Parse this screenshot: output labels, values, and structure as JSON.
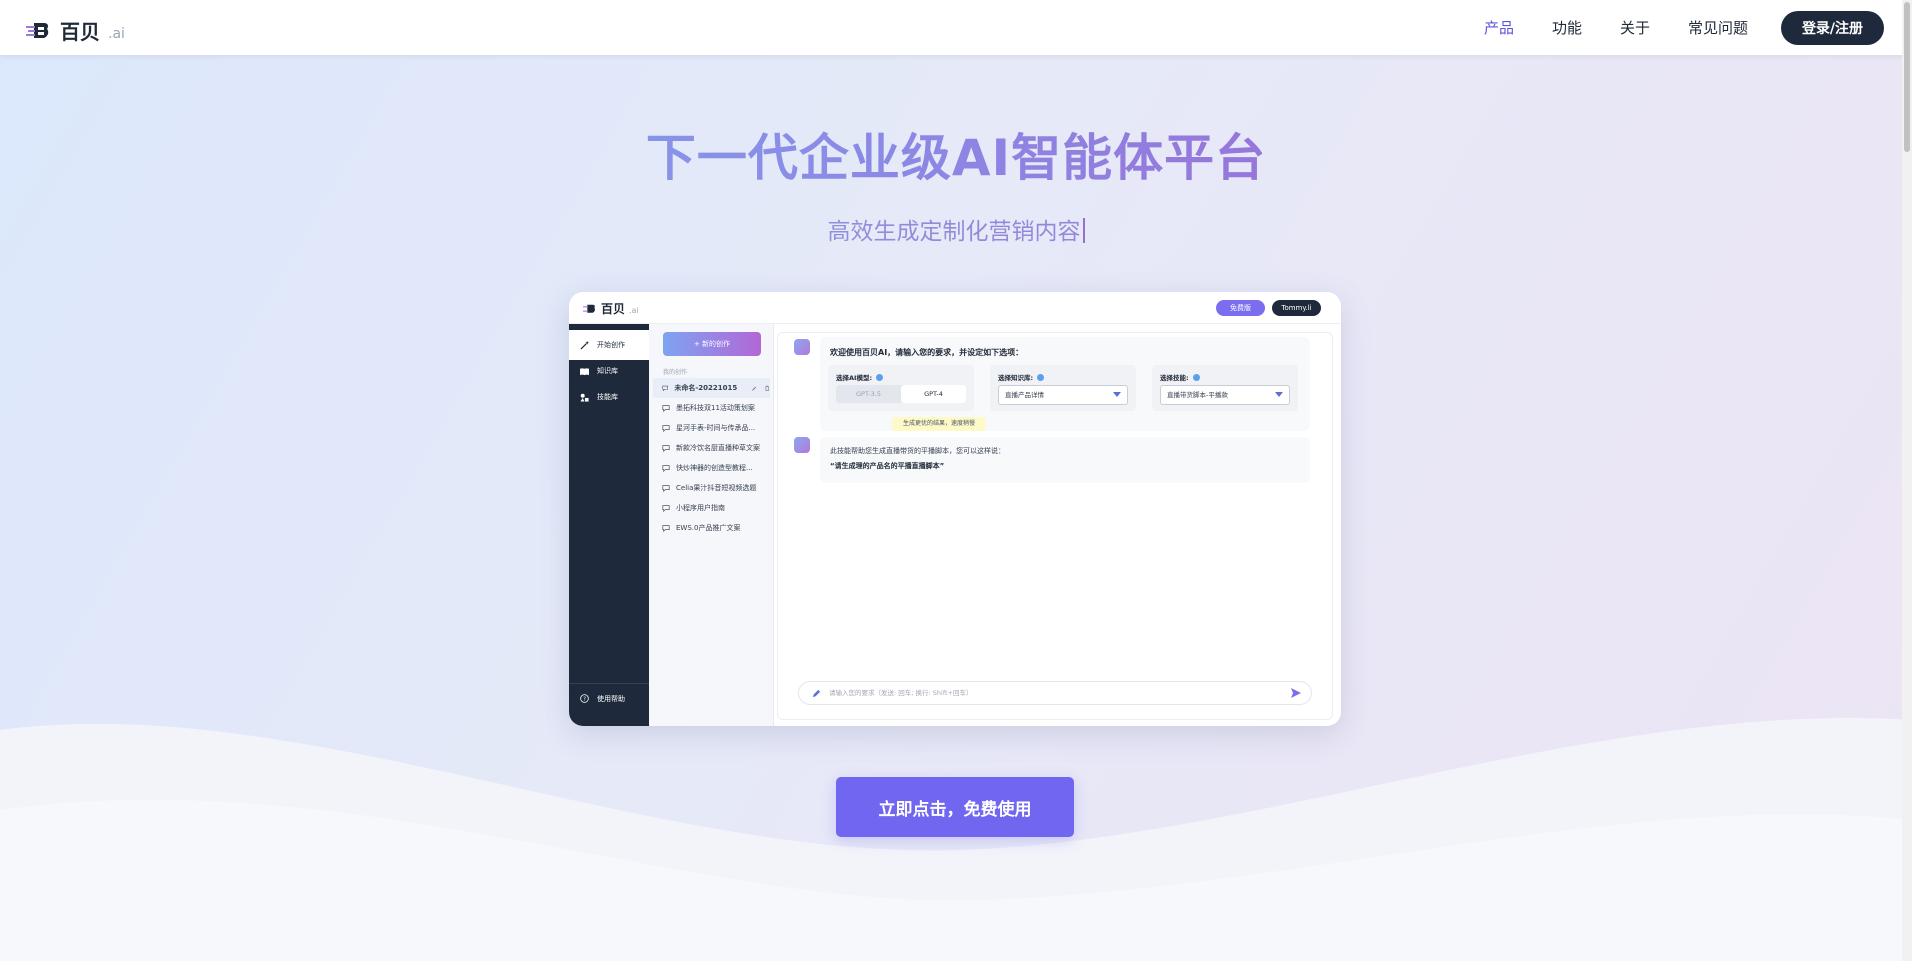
{
  "navbar": {
    "brand": "百贝",
    "brand_suffix": ".ai",
    "links": [
      "产品",
      "功能",
      "关于",
      "常见问题"
    ],
    "active_link": "产品",
    "login_label": "登录/注册"
  },
  "hero": {
    "title": "下一代企业级AI智能体平台",
    "subtitle": "高效生成定制化营销内容"
  },
  "preview": {
    "brand": "百贝",
    "brand_suffix": ".ai",
    "free_pill": "免费版",
    "user_pill": "Tommy.li",
    "sidebar": {
      "items": [
        "开始创作",
        "知识库",
        "技能库"
      ],
      "help": "使用帮助"
    },
    "history": {
      "new_button": "+ 新的创作",
      "label": "我的创作",
      "items": [
        "未命名-20221015",
        "墨拓科技双11活动策划案",
        "星河手表-时间与传承品...",
        "新款冷饮名厨直播种草文案",
        "快炒神器的创造型教程...",
        "Celia果汁抖音短视频选题",
        "小程序用户指南",
        "EWS.0产品推广文案"
      ]
    },
    "chat": {
      "welcome": "欢迎使用百贝AI，请输入您的要求，并设定如下选项：",
      "model_label": "选择AI模型:",
      "model_options": [
        "GPT-3.5",
        "GPT-4"
      ],
      "kb_label": "选择知识库:",
      "kb_value": "直播产品详情",
      "skill_label": "选择技能:",
      "skill_value": "直播带货脚本-平播款",
      "tip": "生成更优的结果，速度稍慢",
      "reply_line1": "此技能帮助您生成直播带货的平播脚本，您可以这样说：",
      "reply_line2": "“请生成理的产品名的平播直播脚本”",
      "input_placeholder": "请输入您的要求（发送: 回车; 换行: Shift+回车）"
    }
  },
  "cta_label": "立即点击，免费使用",
  "colors": {
    "accent": "#7066f0",
    "dark": "#1e293b",
    "nav_active": "#5b55d8"
  }
}
